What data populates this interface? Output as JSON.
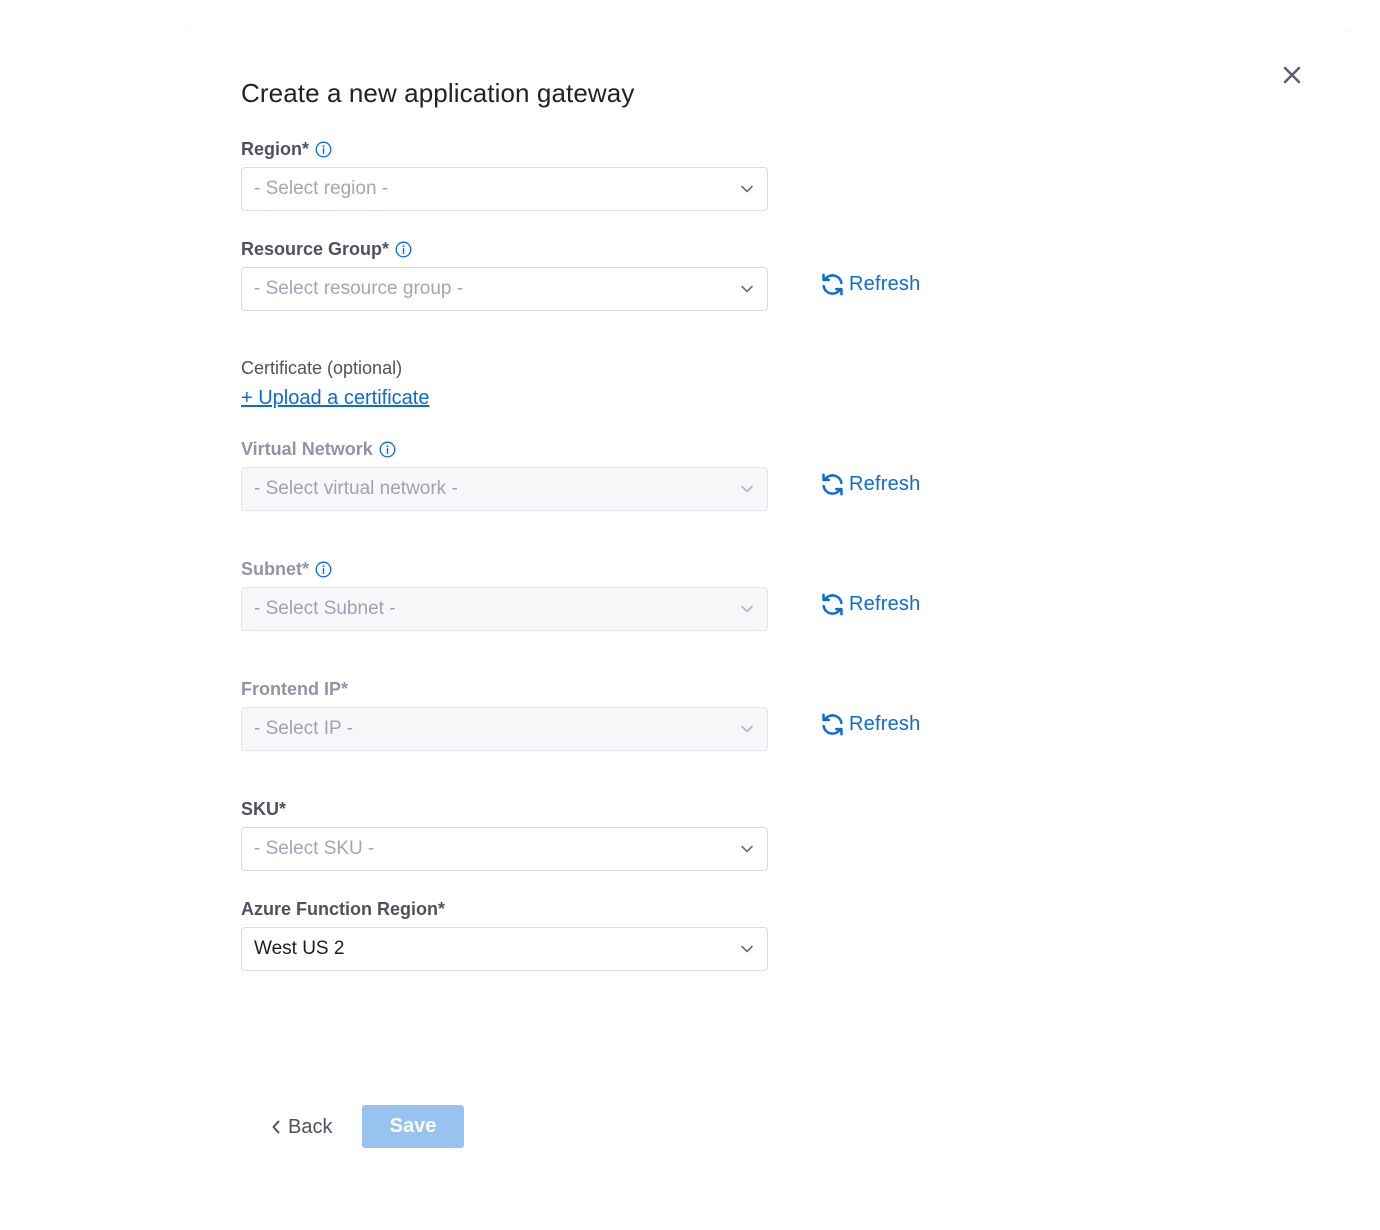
{
  "dialog": {
    "title": "Create a new application gateway",
    "close_icon": "close-icon"
  },
  "fields": {
    "region": {
      "label": "Region*",
      "placeholder": "- Select region -",
      "info_icon": "info-icon",
      "disabled": false
    },
    "resource_group": {
      "label": "Resource Group*",
      "placeholder": "- Select resource group -",
      "info_icon": "info-icon",
      "disabled": false,
      "refresh_label": "Refresh"
    },
    "certificate": {
      "label": "Certificate (optional)",
      "upload_link": "+ Upload a certificate"
    },
    "virtual_network": {
      "label": "Virtual Network",
      "placeholder": "- Select virtual network -",
      "info_icon": "info-icon",
      "disabled": true,
      "refresh_label": "Refresh"
    },
    "subnet": {
      "label": "Subnet*",
      "placeholder": "- Select Subnet -",
      "info_icon": "info-icon",
      "disabled": true,
      "refresh_label": "Refresh"
    },
    "frontend_ip": {
      "label": "Frontend IP*",
      "placeholder": "- Select IP -",
      "disabled": true,
      "refresh_label": "Refresh"
    },
    "sku": {
      "label": "SKU*",
      "placeholder": "- Select SKU -",
      "disabled": false
    },
    "azure_function_region": {
      "label": "Azure Function Region*",
      "value": "West US 2",
      "disabled": false
    }
  },
  "footer": {
    "back_label": "Back",
    "save_label": "Save"
  },
  "colors": {
    "accent": "#0b6bd8",
    "save_disabled": "#98c2ef",
    "label": "#4f5162",
    "label_disabled": "#9293ab"
  }
}
